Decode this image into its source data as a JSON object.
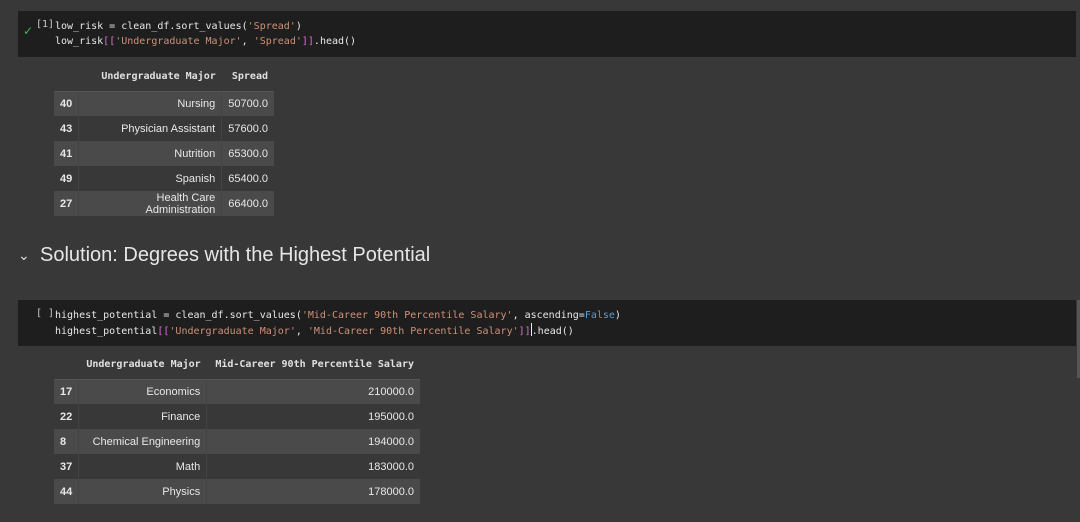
{
  "cell1": {
    "exec_count": "[1]",
    "line1_a": "low_risk = clean_df.sort_values(",
    "line1_str": "'Spread'",
    "line1_b": ")",
    "line2_a": "low_risk",
    "line2_b1": "[[",
    "line2_s1": "'Undergraduate Major'",
    "line2_c": ", ",
    "line2_s2": "'Spread'",
    "line2_b2": "]]",
    "line2_d": ".head()"
  },
  "table1": {
    "headers": [
      "",
      "Undergraduate Major",
      "Spread"
    ],
    "rows": [
      {
        "index": "40",
        "major": "Nursing",
        "value": "50700.0"
      },
      {
        "index": "43",
        "major": "Physician Assistant",
        "value": "57600.0"
      },
      {
        "index": "41",
        "major": "Nutrition",
        "value": "65300.0"
      },
      {
        "index": "49",
        "major": "Spanish",
        "value": "65400.0"
      },
      {
        "index": "27",
        "major": "Health Care Administration",
        "value": "66400.0"
      }
    ]
  },
  "section": {
    "title": "Solution: Degrees with the Highest Potential",
    "chevron": "⌄"
  },
  "cell2": {
    "exec_count": "[ ]",
    "line1_a": "highest_potential = clean_df.sort_values(",
    "line1_str": "'Mid-Career 90th Percentile Salary'",
    "line1_b": ", ascending=",
    "line1_kw": "False",
    "line1_c": ")",
    "line2_a": "highest_potential",
    "line2_b1": "[[",
    "line2_s1": "'Undergraduate Major'",
    "line2_c": ", ",
    "line2_s2": "'Mid-Career 90th Percentile Salary'",
    "line2_b2": "]]",
    "line2_d": ".head()"
  },
  "table2": {
    "headers": [
      "",
      "Undergraduate Major",
      "Mid-Career 90th Percentile Salary"
    ],
    "rows": [
      {
        "index": "17",
        "major": "Economics",
        "value": "210000.0"
      },
      {
        "index": "22",
        "major": "Finance",
        "value": "195000.0"
      },
      {
        "index": "8",
        "major": "Chemical Engineering",
        "value": "194000.0"
      },
      {
        "index": "37",
        "major": "Math",
        "value": "183000.0"
      },
      {
        "index": "44",
        "major": "Physics",
        "value": "178000.0"
      }
    ]
  },
  "icons": {
    "check": "✓"
  }
}
